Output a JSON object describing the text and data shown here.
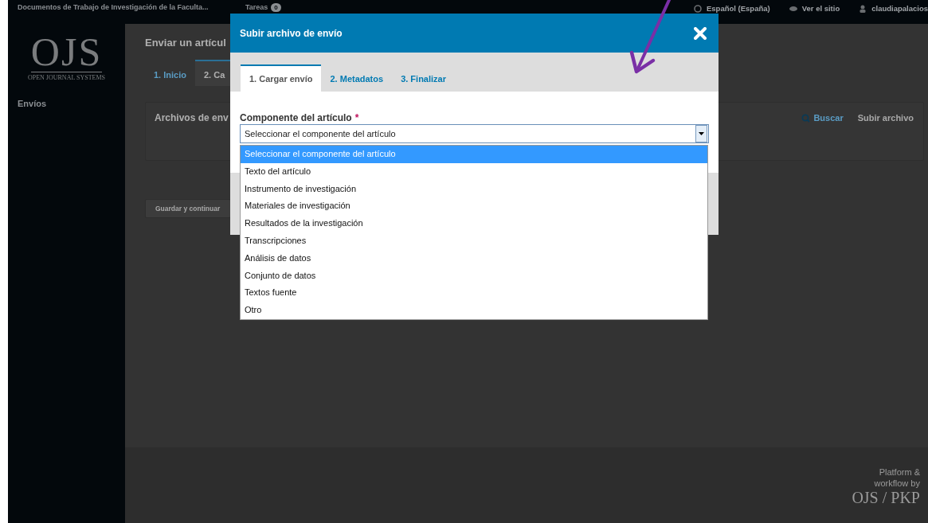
{
  "page": {
    "journal_title": "Documentos de Trabajo de Investigación de la Faculta...",
    "tasks_label": "Tareas",
    "tasks_count": "0",
    "language": "Español (España)",
    "view_site": "Ver el sitio",
    "user": "claudiapalacios",
    "logo": "OJS",
    "logo_subtitle": "OPEN JOURNAL SYSTEMS",
    "sidebar_items": [
      {
        "label": "Envíos",
        "selected": false
      }
    ],
    "heading": "Enviar un artícul",
    "steps": [
      {
        "label": "1. Inicio",
        "selected": false
      },
      {
        "label": "2. Ca",
        "selected": true
      }
    ],
    "files_panel": {
      "title": "Archivos de env",
      "search": "Buscar",
      "upload": "Subir archivo"
    },
    "save_button": "Guardar y continuar",
    "footer": {
      "lines": [
        "Platform &",
        "workflow by"
      ],
      "brand": "OJS / PKP"
    }
  },
  "dialog": {
    "title": "Subir archivo de envío",
    "tabs": [
      {
        "label": "1. Cargar envío",
        "selected": true
      },
      {
        "label": "2. Metadatos",
        "selected": false
      },
      {
        "label": "3. Finalizar",
        "selected": false
      }
    ],
    "field": {
      "label": "Componente del artículo",
      "required": true,
      "required_mark": "*",
      "value": "Seleccionar el componente del artículo",
      "expanded": true,
      "options": [
        {
          "label": "Seleccionar el componente del artículo",
          "selected": true
        },
        {
          "label": "Texto del artículo",
          "selected": false
        },
        {
          "label": "Instrumento de investigación",
          "selected": false
        },
        {
          "label": "Materiales de investigación",
          "selected": false
        },
        {
          "label": "Resultados de la investigación",
          "selected": false
        },
        {
          "label": "Transcripciones",
          "selected": false
        },
        {
          "label": "Análisis de datos",
          "selected": false
        },
        {
          "label": "Conjunto de datos",
          "selected": false
        },
        {
          "label": "Textos fuente",
          "selected": false
        },
        {
          "label": "Otro",
          "selected": false
        }
      ]
    }
  },
  "annotations": [
    {
      "kind": "arrow"
    }
  ]
}
